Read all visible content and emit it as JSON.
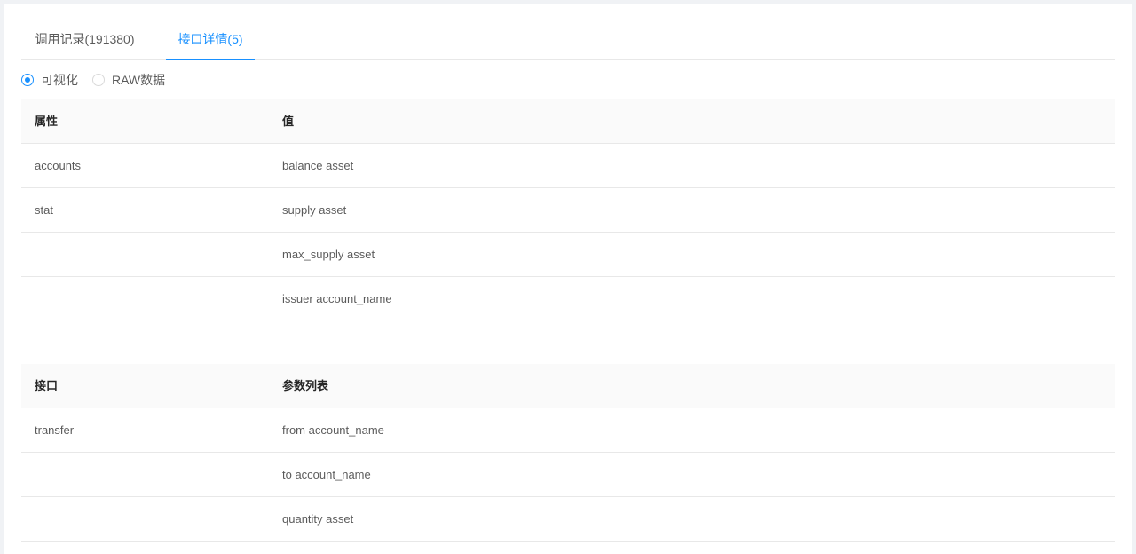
{
  "tabs": [
    {
      "label": "调用记录(191380)",
      "active": false
    },
    {
      "label": "接口详情(5)",
      "active": true
    }
  ],
  "view_mode": {
    "options": [
      {
        "label": "可视化",
        "checked": true
      },
      {
        "label": "RAW数据",
        "checked": false
      }
    ]
  },
  "attributes_table": {
    "headers": [
      "属性",
      "值"
    ],
    "rows": [
      [
        "accounts",
        "balance asset"
      ],
      [
        "stat",
        "supply asset"
      ],
      [
        "",
        "max_supply asset"
      ],
      [
        "",
        "issuer account_name"
      ]
    ]
  },
  "interfaces_table": {
    "headers": [
      "接口",
      "参数列表"
    ],
    "rows": [
      [
        "transfer",
        "from account_name"
      ],
      [
        "",
        "to account_name"
      ],
      [
        "",
        "quantity asset"
      ]
    ]
  },
  "colors": {
    "accent": "#1890ff",
    "header_bg": "#fafafa",
    "border": "#e8e8e8",
    "page_bg": "#f0f2f5"
  }
}
